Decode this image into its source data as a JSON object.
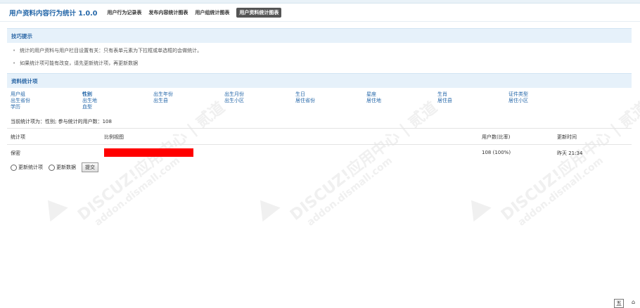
{
  "header": {
    "title": "用户资料内容行为统计 1.0.0",
    "tabs": [
      {
        "label": "用户行为记录表",
        "active": false
      },
      {
        "label": "发布内容统计图表",
        "active": false
      },
      {
        "label": "用户组统计图表",
        "active": false
      },
      {
        "label": "用户资料统计图表",
        "active": true
      }
    ]
  },
  "tips": {
    "title": "技巧提示",
    "items": [
      "统计的用户资料与用户栏目设置有关：只有表单元素为下拉框或单选框的会做统计。",
      "如果统计项可能有改变，请先更新统计项，再更新数据"
    ]
  },
  "stats_section": {
    "title": "资料统计项",
    "items": [
      [
        "用户组",
        "性别",
        "出生年份",
        "出生月份",
        "生日",
        "星座",
        "生肖",
        "证件类型"
      ],
      [
        "出生省份",
        "出生地",
        "出生县",
        "出生小区",
        "居住省份",
        "居住地",
        "居住县",
        "居住小区"
      ],
      [
        "学历",
        "血型"
      ]
    ],
    "current_label": "当前统计项为：性别; 参与统计的用户数：108"
  },
  "table": {
    "headers": {
      "item": "统计项",
      "chart": "比例视图",
      "count": "用户数(比率)",
      "time": "更新时间"
    },
    "rows": [
      {
        "item": "保密",
        "ratio": 1.0,
        "count": "108 (100%)",
        "time": "昨天 21:34"
      }
    ],
    "bar_color": "#ff0000"
  },
  "controls": {
    "option_items": "更新统计项",
    "option_data": "更新数据",
    "submit": "提交"
  },
  "watermark": {
    "brand": "DISCUZ!应用中心 | 贰道",
    "url": "addon.dismall.com"
  },
  "corner": {
    "left": "五",
    "right": "⌂"
  }
}
